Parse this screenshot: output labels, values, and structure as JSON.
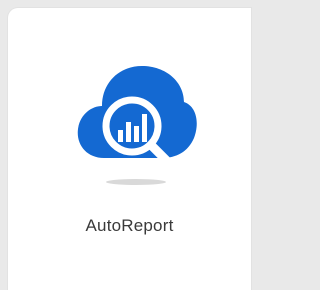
{
  "app": {
    "name": "AutoReport",
    "icon": "cloud-magnifier-bar-chart-icon"
  },
  "colors": {
    "brand_blue": "#1469d2",
    "card_bg": "#ffffff",
    "page_bg": "#e9e9e9"
  }
}
